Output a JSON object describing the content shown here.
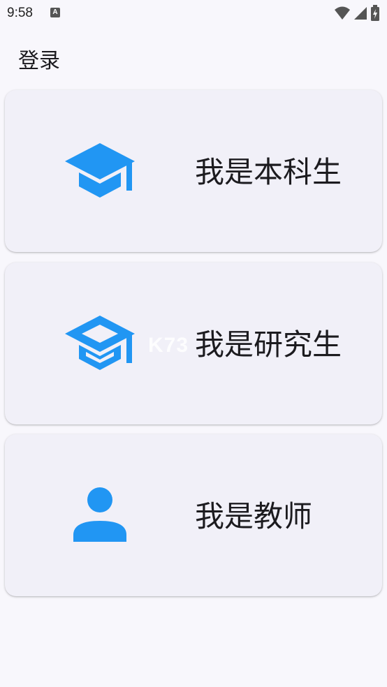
{
  "status_bar": {
    "time": "9:58",
    "notification_badge": "A",
    "icons": [
      "wifi-icon",
      "signal-icon",
      "battery-icon"
    ]
  },
  "app_bar": {
    "title": "登录"
  },
  "roles": [
    {
      "label": "我是本科生",
      "icon": "graduation-cap-filled-icon"
    },
    {
      "label": "我是研究生",
      "icon": "graduation-cap-outlined-icon"
    },
    {
      "label": "我是教师",
      "icon": "person-icon"
    }
  ],
  "watermark": {
    "text": "K73"
  },
  "colors": {
    "icon_accent": "#2196f3",
    "background": "#f8f7fc",
    "card_background": "#f1f0f8",
    "text": "#1c1b1f"
  }
}
